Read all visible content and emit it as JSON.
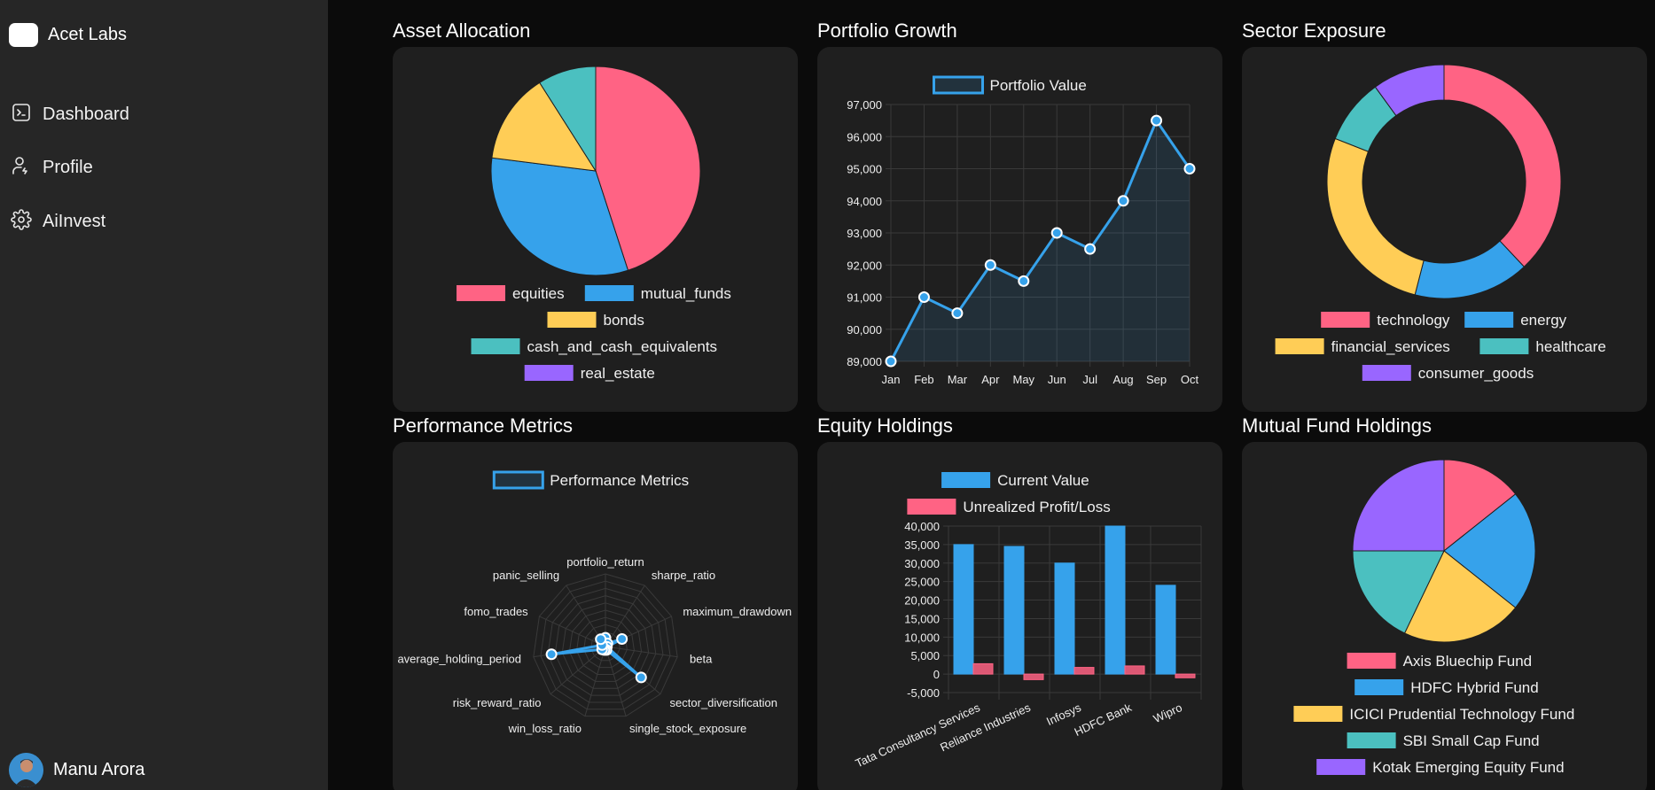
{
  "sidebar": {
    "brand": "Acet Labs",
    "items": [
      {
        "label": "Dashboard",
        "icon": "terminal-icon"
      },
      {
        "label": "Profile",
        "icon": "user-icon"
      },
      {
        "label": "AiInvest",
        "icon": "gear-icon"
      }
    ],
    "user": {
      "name": "Manu Arora"
    }
  },
  "titles": {
    "allocation": "Asset Allocation",
    "growth": "Portfolio Growth",
    "sector": "Sector Exposure",
    "performance": "Performance Metrics",
    "equity": "Equity Holdings",
    "mutual": "Mutual Fund Holdings"
  },
  "colors": {
    "pink": "#ff6384",
    "blue": "#36a2eb",
    "yellow": "#ffcd56",
    "teal": "#4bc0c0",
    "purple": "#9966ff"
  },
  "chart_data": [
    {
      "id": "allocation",
      "type": "pie",
      "labels": [
        "equities",
        "mutual_funds",
        "bonds",
        "cash_and_cash_equivalents",
        "real_estate"
      ],
      "values": [
        45,
        32,
        14,
        9,
        0
      ]
    },
    {
      "id": "growth",
      "type": "line",
      "categories": [
        "Jan",
        "Feb",
        "Mar",
        "Apr",
        "May",
        "Jun",
        "Jul",
        "Aug",
        "Sep",
        "Oct"
      ],
      "series": [
        {
          "name": "Portfolio Value",
          "values": [
            89000,
            91000,
            90500,
            92000,
            91500,
            93000,
            92500,
            94000,
            96500,
            95000
          ]
        }
      ],
      "ylim": [
        89000,
        97000
      ],
      "yticks": [
        "89,000",
        "90,000",
        "91,000",
        "92,000",
        "93,000",
        "94,000",
        "95,000",
        "96,000",
        "97,000"
      ],
      "grid": true,
      "legend": "top"
    },
    {
      "id": "sector",
      "type": "pie",
      "variant": "doughnut",
      "labels": [
        "technology",
        "energy",
        "financial_services",
        "healthcare",
        "consumer_goods"
      ],
      "values": [
        38,
        16,
        27,
        9,
        10
      ]
    },
    {
      "id": "performance",
      "type": "radar",
      "labels": [
        "portfolio_return",
        "sharpe_ratio",
        "maximum_drawdown",
        "beta",
        "sector_diversification",
        "single_stock_exposure",
        "win_loss_ratio",
        "risk_reward_ratio",
        "average_holding_period",
        "fomo_trades",
        "panic_selling"
      ],
      "series": [
        {
          "name": "Performance Metrics",
          "values": [
            0.12,
            0.05,
            0.25,
            0.02,
            0.65,
            0.05,
            0.05,
            0.06,
            0.75,
            0.05,
            0.12
          ]
        }
      ],
      "max": 1,
      "legend": "top"
    },
    {
      "id": "equity",
      "type": "bar",
      "categories": [
        "Tata Consultancy Services",
        "Reliance Industries",
        "Infosys",
        "HDFC Bank",
        "Wipro"
      ],
      "series": [
        {
          "name": "Current Value",
          "values": [
            35000,
            34500,
            30000,
            40000,
            24000
          ]
        },
        {
          "name": "Unrealized Profit/Loss",
          "values": [
            2800,
            -1500,
            1800,
            2200,
            -1000
          ]
        }
      ],
      "ylim": [
        -5000,
        40000
      ],
      "yticks": [
        "-5,000",
        "0",
        "5,000",
        "10,000",
        "15,000",
        "20,000",
        "25,000",
        "30,000",
        "35,000",
        "40,000"
      ],
      "grid": true,
      "legend": "top"
    },
    {
      "id": "mutual",
      "type": "pie",
      "labels": [
        "Axis Bluechip Fund",
        "HDFC Hybrid Fund",
        "ICICI Prudential Technology Fund",
        "SBI Small Cap Fund",
        "Kotak Emerging Equity Fund"
      ],
      "values": [
        14.3,
        21.4,
        21.4,
        17.9,
        25
      ]
    }
  ]
}
